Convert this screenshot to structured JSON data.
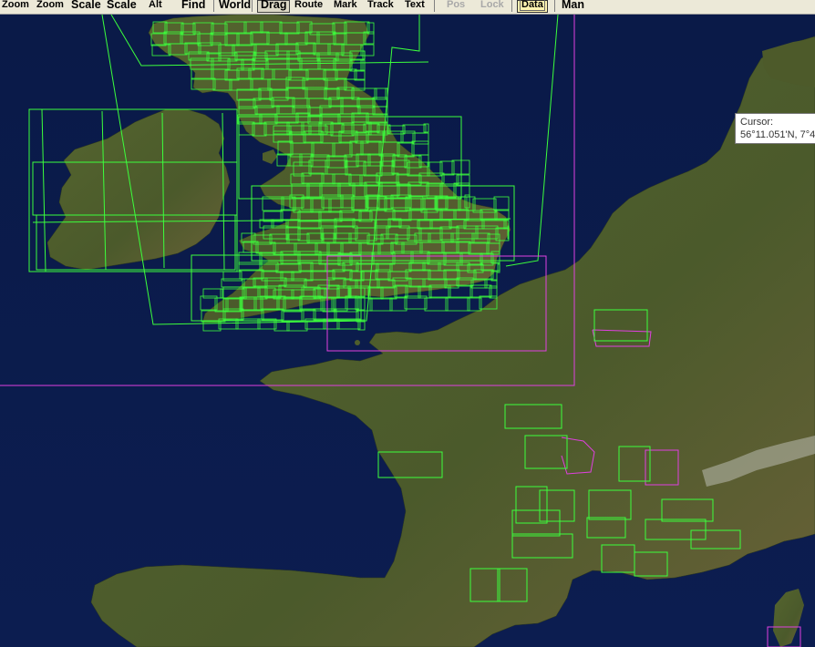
{
  "toolbar": {
    "zoom_in": "Zoom",
    "zoom_out": "Zoom",
    "scale_up": "Scale",
    "scale_down": "Scale",
    "alt": "Alt",
    "find": "Find",
    "world": "World",
    "drag": "Drag",
    "route": "Route",
    "mark": "Mark",
    "track": "Track",
    "text": "Text",
    "pos": "Pos",
    "lock": "Lock",
    "data": "Data",
    "man": "Man"
  },
  "toolbar_state": {
    "drag_pressed": true,
    "pos_disabled": true,
    "lock_disabled": true,
    "data_highlighted": true
  },
  "cursor_tooltip": {
    "label": "Cursor:",
    "value": "56°11.051'N, 7°4"
  },
  "map_colors": {
    "sea": "#0b1b4a",
    "land": "#4f5e2c",
    "chart_outline_green": "#3cff3c",
    "chart_outline_magenta": "#e040e0"
  }
}
